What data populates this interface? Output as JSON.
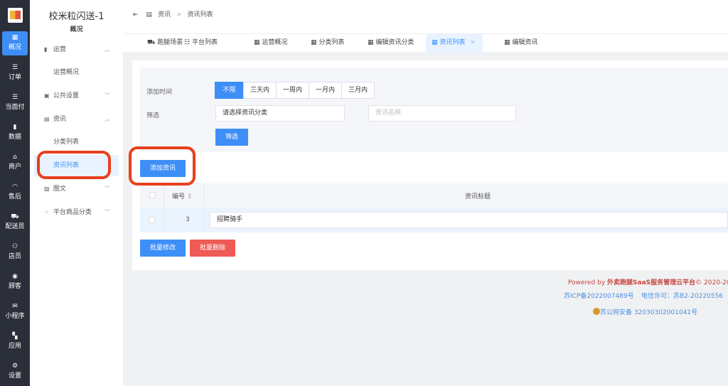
{
  "rail": {
    "items": [
      {
        "label": "概况",
        "icon": "grid-icon",
        "glyph": "▦"
      },
      {
        "label": "订单",
        "icon": "list-icon",
        "glyph": "☰"
      },
      {
        "label": "当面付",
        "icon": "list-icon",
        "glyph": "☰"
      },
      {
        "label": "数据",
        "icon": "bar-chart-icon",
        "glyph": "▮"
      },
      {
        "label": "商户",
        "icon": "store-icon",
        "glyph": "⌂"
      },
      {
        "label": "售后",
        "icon": "headset-icon",
        "glyph": "◠"
      },
      {
        "label": "配送员",
        "icon": "scooter-icon",
        "glyph": "⛟"
      },
      {
        "label": "店员",
        "icon": "users-icon",
        "glyph": "⚇"
      },
      {
        "label": "顾客",
        "icon": "user-circle-icon",
        "glyph": "◉"
      },
      {
        "label": "小程序",
        "icon": "chat-icon",
        "glyph": "✉"
      },
      {
        "label": "应用",
        "icon": "apps-icon",
        "glyph": "▚"
      },
      {
        "label": "设置",
        "icon": "user-gear-icon",
        "glyph": "⚙"
      }
    ]
  },
  "sidebar": {
    "title": "校米粒闪送-1",
    "subtitle": "概况",
    "items": [
      {
        "label": "运营",
        "icon": "bar-icon"
      },
      {
        "label": "运营概况"
      },
      {
        "label": "公共设置",
        "icon": "image-icon"
      },
      {
        "label": "资讯",
        "icon": "news-icon"
      },
      {
        "label": "分类列表"
      },
      {
        "label": "资讯列表"
      },
      {
        "label": "图文",
        "icon": "picture-icon"
      },
      {
        "label": "平台商品分类",
        "icon": "grid-icon"
      }
    ]
  },
  "breadcrumb": {
    "items": [
      "资讯",
      ">",
      "资讯列表"
    ]
  },
  "tabs": [
    "跑腿场景",
    "平台列表",
    "运营概况",
    "分类列表",
    "编辑资讯分类",
    "资讯列表",
    "编辑资讯"
  ],
  "tab_close": "×",
  "filter": {
    "time_label": "添加时间",
    "time_options": [
      "不限",
      "三天内",
      "一周内",
      "一月内",
      "三月内"
    ],
    "filter_label": "筛选",
    "category_select": "请选择资讯分类",
    "name_placeholder": "资讯名称",
    "filter_button": "筛选"
  },
  "add_button": "添加资讯",
  "table": {
    "headers": [
      "编号",
      "资讯标题"
    ],
    "sort_icon": "⇕",
    "rows": [
      {
        "id": "3",
        "title": "招聘骑手"
      }
    ]
  },
  "batch_edit": "批量修改",
  "batch_delete": "批量删除",
  "footer": {
    "powered_prefix": "Powered by ",
    "brand": "外卖跑腿SaaS服务管理云平台",
    "copyright": "© 2020-20",
    "icp": "苏ICP备2022007489号",
    "telecom": "电信许可：苏B2-20220556",
    "police": "苏公网安备 32030302001041号"
  },
  "colors": {
    "primary": "#3d8ef7",
    "danger": "#ee5a55",
    "highlight": "#e8401c",
    "rail": "#2b2f3a"
  }
}
